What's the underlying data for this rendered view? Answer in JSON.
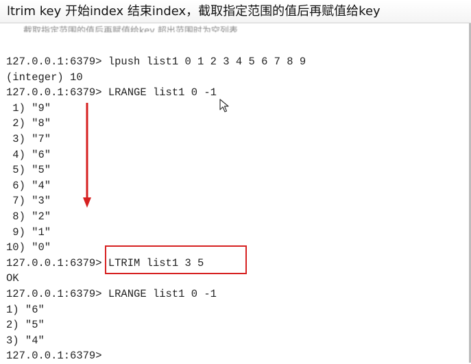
{
  "title": "ltrim key 开始index 结束index，截取指定范围的值后再赋值给key",
  "clipped_text": "……截取指定范围的值后再赋值给key 超出范围时为空列表",
  "terminal": {
    "lines": [
      {
        "prompt": "127.0.0.1:6379> ",
        "text": "lpush list1 0 1 2 3 4 5 6 7 8 9"
      },
      {
        "prompt": "",
        "text": "(integer) 10"
      },
      {
        "prompt": "127.0.0.1:6379> ",
        "text": "LRANGE list1 0 -1"
      },
      {
        "prompt": "",
        "text": " 1) \"9\""
      },
      {
        "prompt": "",
        "text": " 2) \"8\""
      },
      {
        "prompt": "",
        "text": " 3) \"7\""
      },
      {
        "prompt": "",
        "text": " 4) \"6\""
      },
      {
        "prompt": "",
        "text": " 5) \"5\""
      },
      {
        "prompt": "",
        "text": " 6) \"4\""
      },
      {
        "prompt": "",
        "text": " 7) \"3\""
      },
      {
        "prompt": "",
        "text": " 8) \"2\""
      },
      {
        "prompt": "",
        "text": " 9) \"1\""
      },
      {
        "prompt": "",
        "text": "10) \"0\""
      },
      {
        "prompt": "127.0.0.1:6379> ",
        "text": "LTRIM list1 3 5"
      },
      {
        "prompt": "",
        "text": "OK"
      },
      {
        "prompt": "127.0.0.1:6379> ",
        "text": "LRANGE list1 0 -1"
      },
      {
        "prompt": "",
        "text": "1) \"6\""
      },
      {
        "prompt": "",
        "text": "2) \"5\""
      },
      {
        "prompt": "",
        "text": "3) \"4\""
      },
      {
        "prompt": "127.0.0.1:6379> ",
        "text": ""
      }
    ]
  },
  "colors": {
    "annotation": "#d62020",
    "text": "#222222",
    "background": "#ffffff"
  },
  "icons": [
    "down-arrow-annotation-icon",
    "mouse-cursor-icon"
  ]
}
